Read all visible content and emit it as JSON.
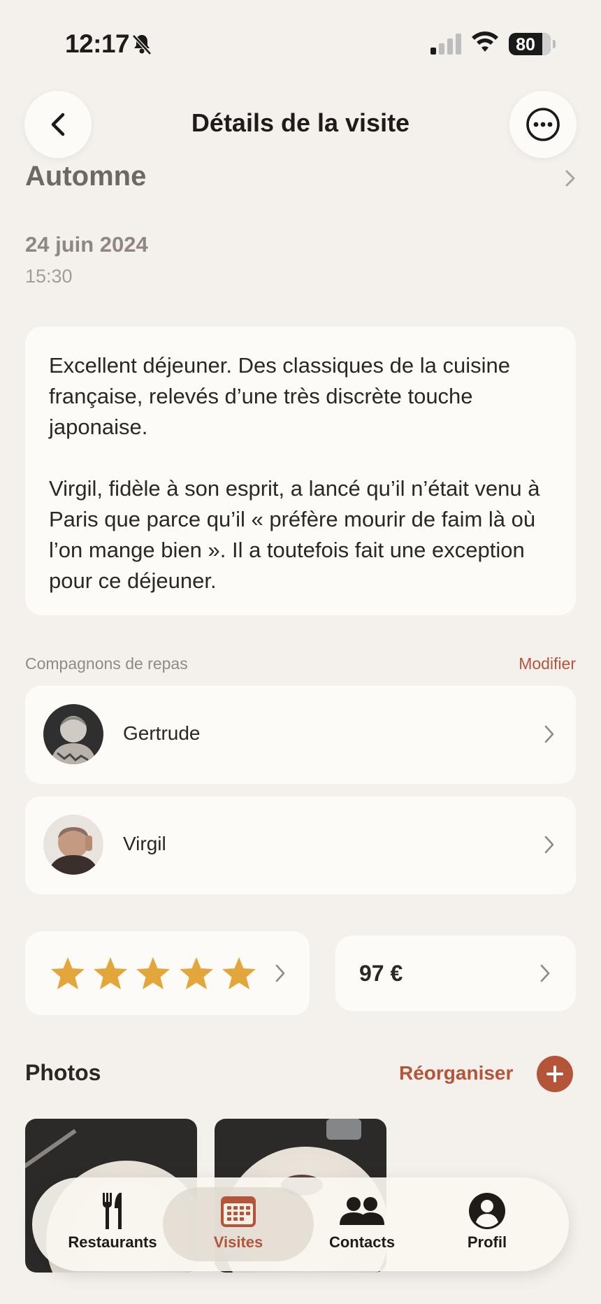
{
  "status_bar": {
    "time": "12:17",
    "battery": "80"
  },
  "header": {
    "title": "Détails de la visite"
  },
  "restaurant": {
    "name": "Automne"
  },
  "visit": {
    "date": "24 juin 2024",
    "time": "15:30"
  },
  "note": {
    "paragraph_1": "Excellent déjeuner. Des classiques de la cuisine française, relevés d’une très discrète touche japonaise.",
    "paragraph_2": "Virgil, fidèle à son esprit, a lancé qu’il n’était venu à Paris que parce qu’il « préfère mourir de faim là où l’on mange bien ». Il a toutefois fait une exception pour ce déjeuner."
  },
  "companions": {
    "label": "Compagnons de repas",
    "edit_label": "Modifier",
    "items": [
      {
        "name": "Gertrude"
      },
      {
        "name": "Virgil"
      }
    ]
  },
  "rating": {
    "stars": 5,
    "max": 5,
    "star_color": "#e3a63a"
  },
  "price": {
    "value": "97 €"
  },
  "photos": {
    "title": "Photos",
    "reorganize_label": "Réorganiser"
  },
  "tab_bar": {
    "items": [
      {
        "label": "Restaurants",
        "icon": "fork-knife-icon"
      },
      {
        "label": "Visites",
        "icon": "calendar-icon",
        "active": true
      },
      {
        "label": "Contacts",
        "icon": "people-icon"
      },
      {
        "label": "Profil",
        "icon": "person-circle-icon"
      }
    ]
  },
  "colors": {
    "accent": "#b4553a",
    "background": "#f4f1ec",
    "card": "#fdfbf7"
  }
}
